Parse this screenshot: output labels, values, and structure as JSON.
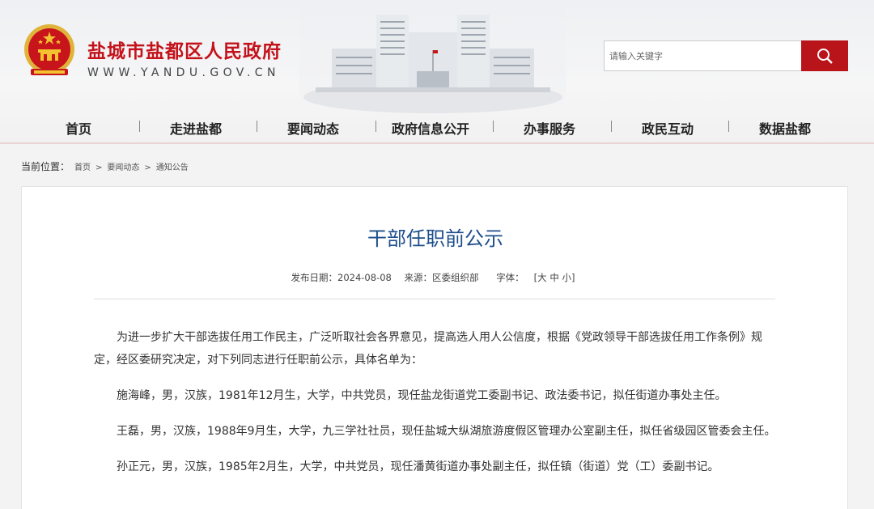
{
  "site": {
    "title": "盐城市盐都区人民政府",
    "url": "WWW.YANDU.GOV.CN"
  },
  "search": {
    "placeholder": "请输入关键字",
    "icon": "search-icon"
  },
  "nav": [
    "首页",
    "走进盐都",
    "要闻动态",
    "政府信息公开",
    "办事服务",
    "政民互动",
    "数据盐都"
  ],
  "breadcrumb": {
    "label": "当前位置：",
    "items": [
      "首页",
      "要闻动态",
      "通知公告"
    ]
  },
  "article": {
    "title": "干部任职前公示",
    "meta": {
      "date_label": "发布日期：2024-08-08",
      "source_label": "来源：区委组织部",
      "font_label": "字体：",
      "font_sizes": "[大 中 小]"
    },
    "paragraphs": [
      "为进一步扩大干部选拔任用工作民主，广泛听取社会各界意见，提高选人用人公信度，根据《党政领导干部选拔任用工作条例》规定，经区委研究决定，对下列同志进行任职前公示，具体名单为：",
      "施海峰，男，汉族，1981年12月生，大学，中共党员，现任盐龙街道党工委副书记、政法委书记，拟任街道办事处主任。",
      "王磊，男，汉族，1988年9月生，大学，九三学社社员，现任盐城大纵湖旅游度假区管理办公室副主任，拟任省级园区管委会主任。",
      "孙正元，男，汉族，1985年2月生，大学，中共党员，现任潘黄街道办事处副主任，拟任镇（街道）党（工）委副书记。"
    ]
  },
  "colors": {
    "brand_red": "#c4121a",
    "title_blue": "#1e4e8c"
  }
}
